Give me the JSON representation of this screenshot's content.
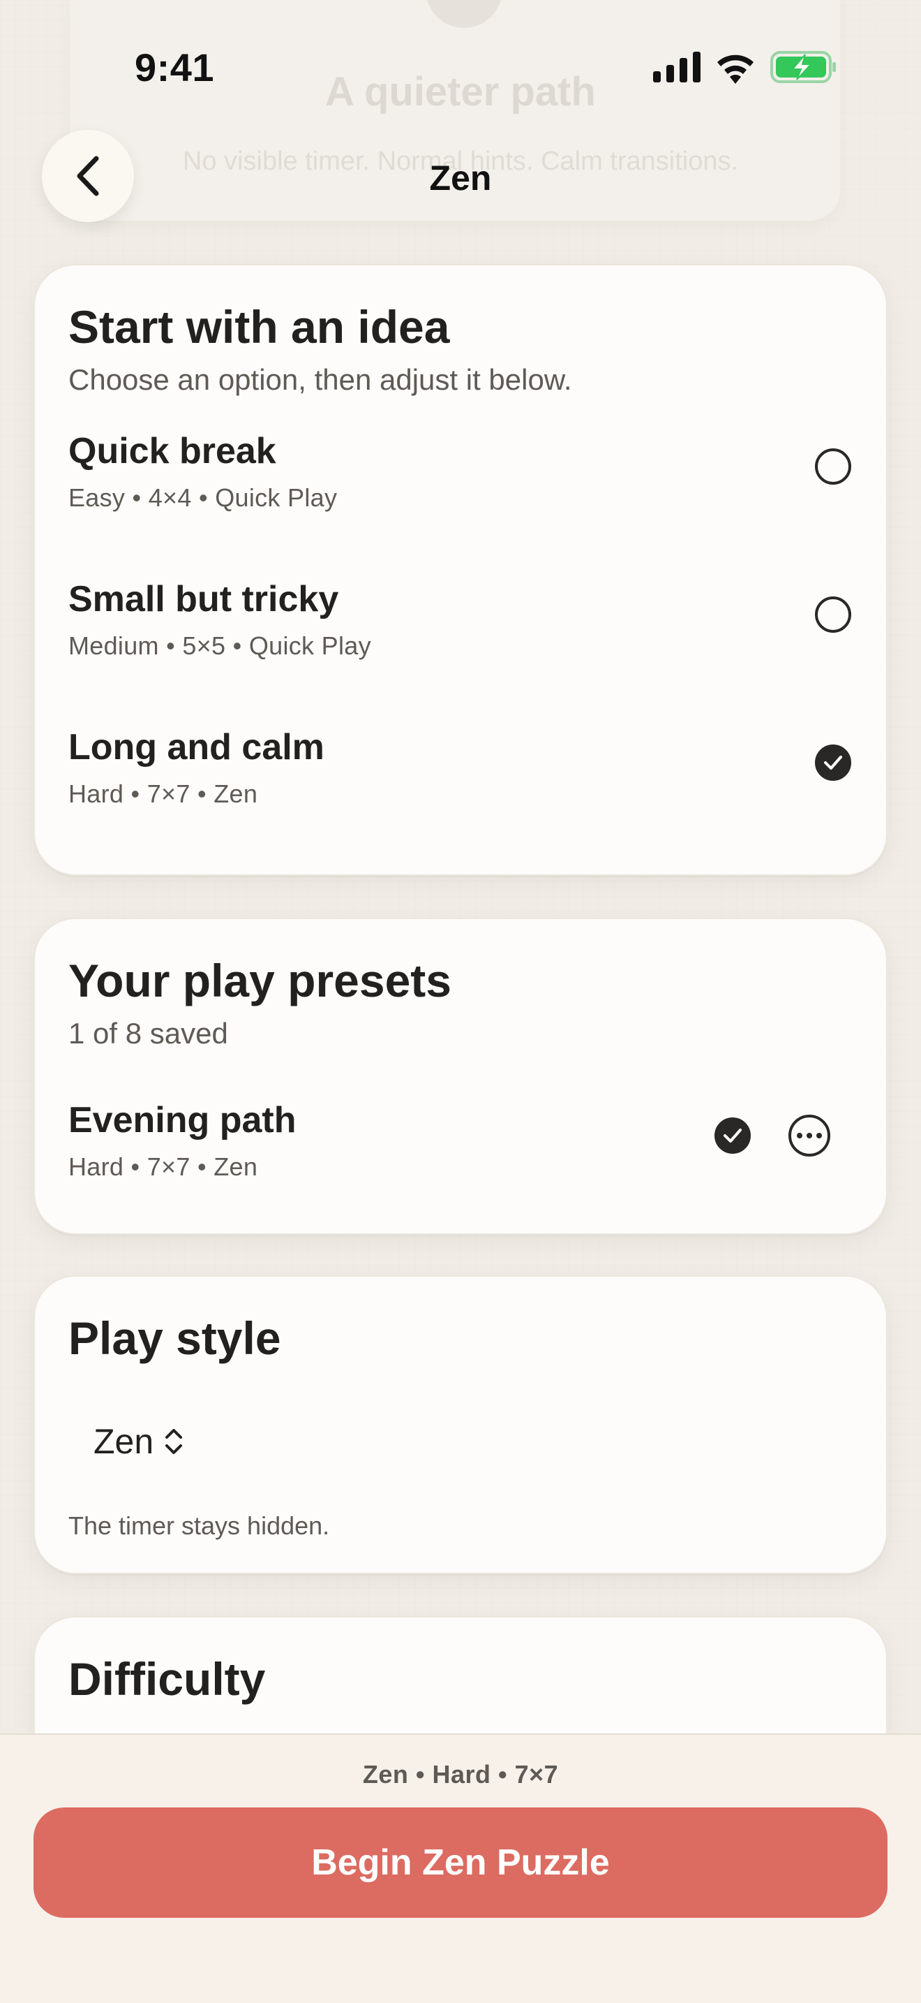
{
  "status_bar": {
    "time": "9:41"
  },
  "background_card": {
    "title": "A quieter path",
    "subtitle": "No visible timer. Normal hints. Calm transitions."
  },
  "nav": {
    "title": "Zen"
  },
  "ideas": {
    "title": "Start with an idea",
    "subtitle": "Choose an option, then adjust it below.",
    "options": [
      {
        "title": "Quick break",
        "meta": "Easy • 4×4 • Quick Play",
        "selected": false
      },
      {
        "title": "Small but tricky",
        "meta": "Medium • 5×5 • Quick Play",
        "selected": false
      },
      {
        "title": "Long and calm",
        "meta": "Hard • 7×7 • Zen",
        "selected": true
      }
    ]
  },
  "presets": {
    "title": "Your play presets",
    "subtitle": "1 of 8 saved",
    "items": [
      {
        "title": "Evening path",
        "meta": "Hard • 7×7 • Zen",
        "selected": true
      }
    ]
  },
  "play_style": {
    "title": "Play style",
    "value": "Zen",
    "note": "The timer stays hidden."
  },
  "difficulty": {
    "title": "Difficulty"
  },
  "bottom": {
    "summary": "Zen • Hard • 7×7",
    "button_label": "Begin Zen Puzzle"
  },
  "colors": {
    "accent": "#dc6b61",
    "battery_green": "#34c759",
    "background": "#f1ede6"
  }
}
